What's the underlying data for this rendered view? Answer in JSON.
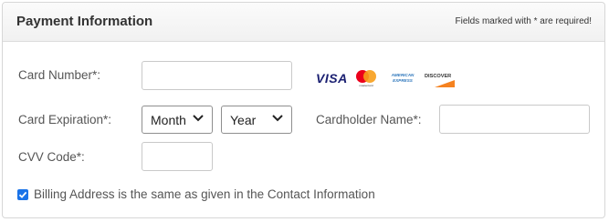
{
  "panel": {
    "title": "Payment Information",
    "required_note": "Fields marked with * are required!"
  },
  "form": {
    "card_number_label": "Card Number*:",
    "card_number_value": "",
    "card_expiration_label": "Card Expiration*:",
    "month_selected": "Month",
    "year_selected": "Year",
    "cardholder_label": "Cardholder Name*:",
    "cardholder_value": "",
    "cvv_label": "CVV Code*:",
    "cvv_value": "",
    "billing_checkbox_checked": true,
    "billing_checkbox_label": "Billing Address is the same as given in the Contact Information"
  },
  "card_logos": {
    "visa_text": "VISA",
    "mastercard_text": "mastercard",
    "amex_text": "AMERICAN EXPRESS",
    "discover_text": "DISCOVER"
  },
  "colors": {
    "accent_checkbox": "#1a73e8",
    "visa_blue": "#1a1f71",
    "mastercard_red": "#eb001b",
    "mastercard_orange": "#f79e1b",
    "amex_blue": "#2e77bc",
    "discover_orange": "#f58220"
  }
}
